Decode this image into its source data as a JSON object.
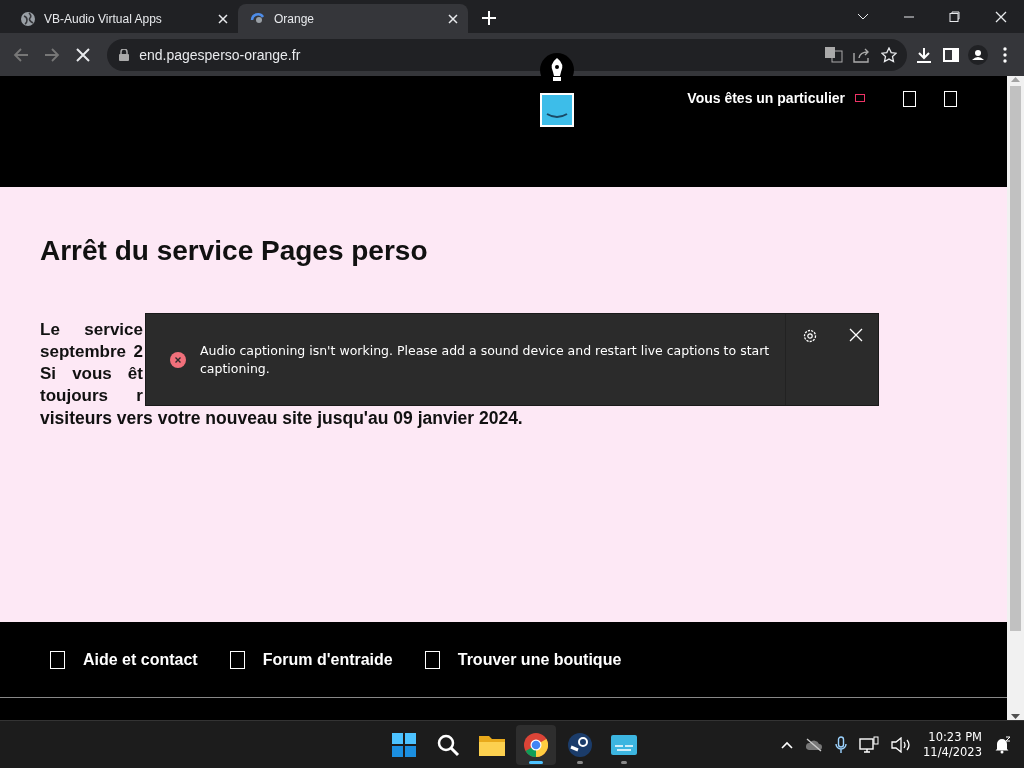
{
  "tabs": [
    {
      "title": "VB-Audio Virtual Apps",
      "kind": "globe",
      "selected": false
    },
    {
      "title": "Orange",
      "kind": "loading",
      "selected": true
    }
  ],
  "address": "end.pagesperso-orange.fr",
  "header": {
    "link": "Vous êtes un particulier"
  },
  "main": {
    "heading": "Arrêt du service Pages perso",
    "visible_lines": [
      "Le service",
      "septembre 2",
      "Si vous êt",
      "toujours r",
      "visiteurs vers votre nouveau site jusqu'au 09 janvier 2024."
    ]
  },
  "caption_notice": {
    "message": "Audio captioning isn't working. Please add a sound device and restart live captions to start captioning."
  },
  "footer_links": [
    "Aide et contact",
    "Forum d'entraide",
    "Trouver une boutique"
  ],
  "taskbar": {
    "apps": [
      {
        "kind": "start",
        "selected": false
      },
      {
        "kind": "search",
        "selected": false
      },
      {
        "kind": "folder",
        "selected": false
      },
      {
        "kind": "chrome",
        "selected": true
      },
      {
        "kind": "steam",
        "selected": false
      },
      {
        "kind": "captions",
        "selected": false
      }
    ],
    "time": "10:23 PM",
    "date": "11/4/2023"
  }
}
